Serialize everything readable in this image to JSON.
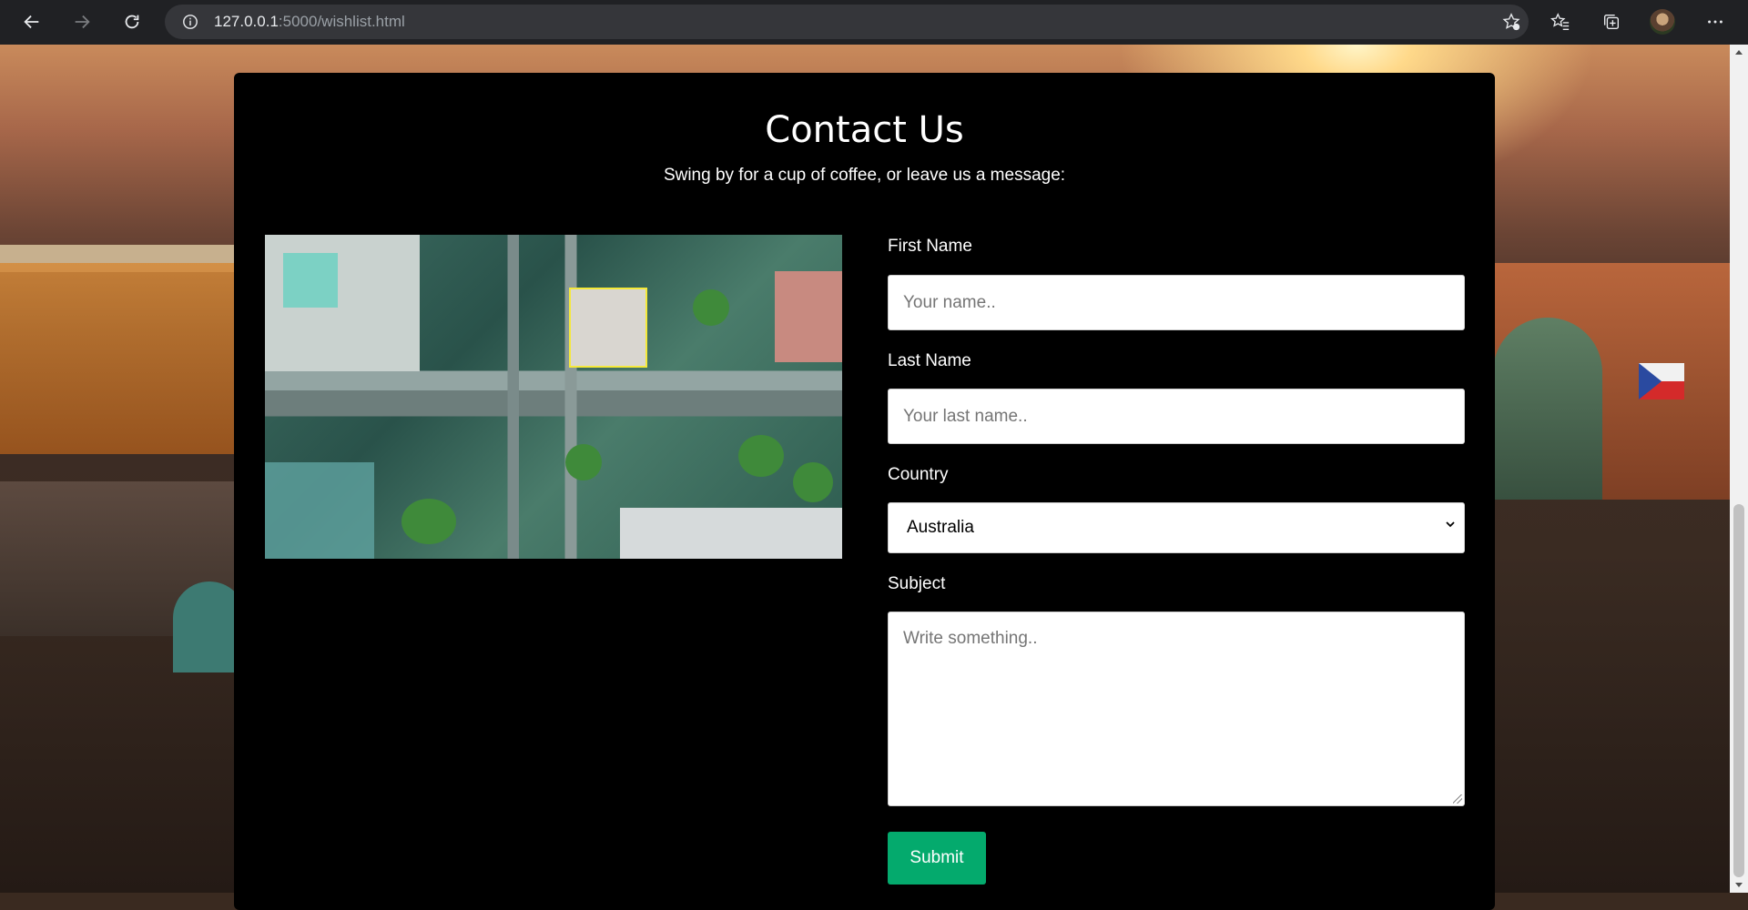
{
  "browser": {
    "url_host": "127.0.0.1",
    "url_path": ":5000/wishlist.html",
    "icons": {
      "back": "back-arrow-icon",
      "forward": "forward-arrow-icon",
      "reload": "reload-icon",
      "info": "info-icon",
      "add_favorite": "add-favorite-icon",
      "favorites": "favorites-icon",
      "collections": "collections-icon",
      "profile": "profile-avatar",
      "menu": "more-menu-icon"
    }
  },
  "contact": {
    "title": "Contact Us",
    "subtitle": "Swing by for a cup of coffee, or leave us a message:",
    "first_name": {
      "label": "First Name",
      "placeholder": "Your name.."
    },
    "last_name": {
      "label": "Last Name",
      "placeholder": "Your last name.."
    },
    "country": {
      "label": "Country",
      "selected": "Australia"
    },
    "subject": {
      "label": "Subject",
      "placeholder": "Write something.."
    },
    "submit_label": "Submit",
    "accent_color": "#04aa6d"
  }
}
